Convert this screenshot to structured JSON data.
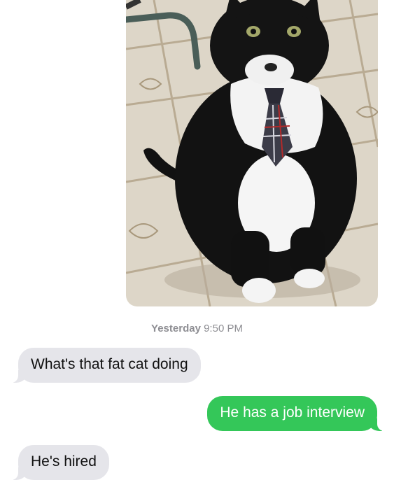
{
  "photo": {
    "subject": "cat-wearing-tie-photo"
  },
  "timestamp": {
    "day": "Yesterday",
    "time": "9:50 PM"
  },
  "messages": [
    {
      "direction": "incoming",
      "text": "What's that fat cat doing"
    },
    {
      "direction": "outgoing",
      "text": "He has a job interview"
    },
    {
      "direction": "incoming",
      "text": "He's hired"
    }
  ],
  "colors": {
    "incoming_bubble": "#e5e5ea",
    "outgoing_bubble": "#34c759",
    "timestamp": "#8e8e93",
    "background": "#ffffff"
  }
}
